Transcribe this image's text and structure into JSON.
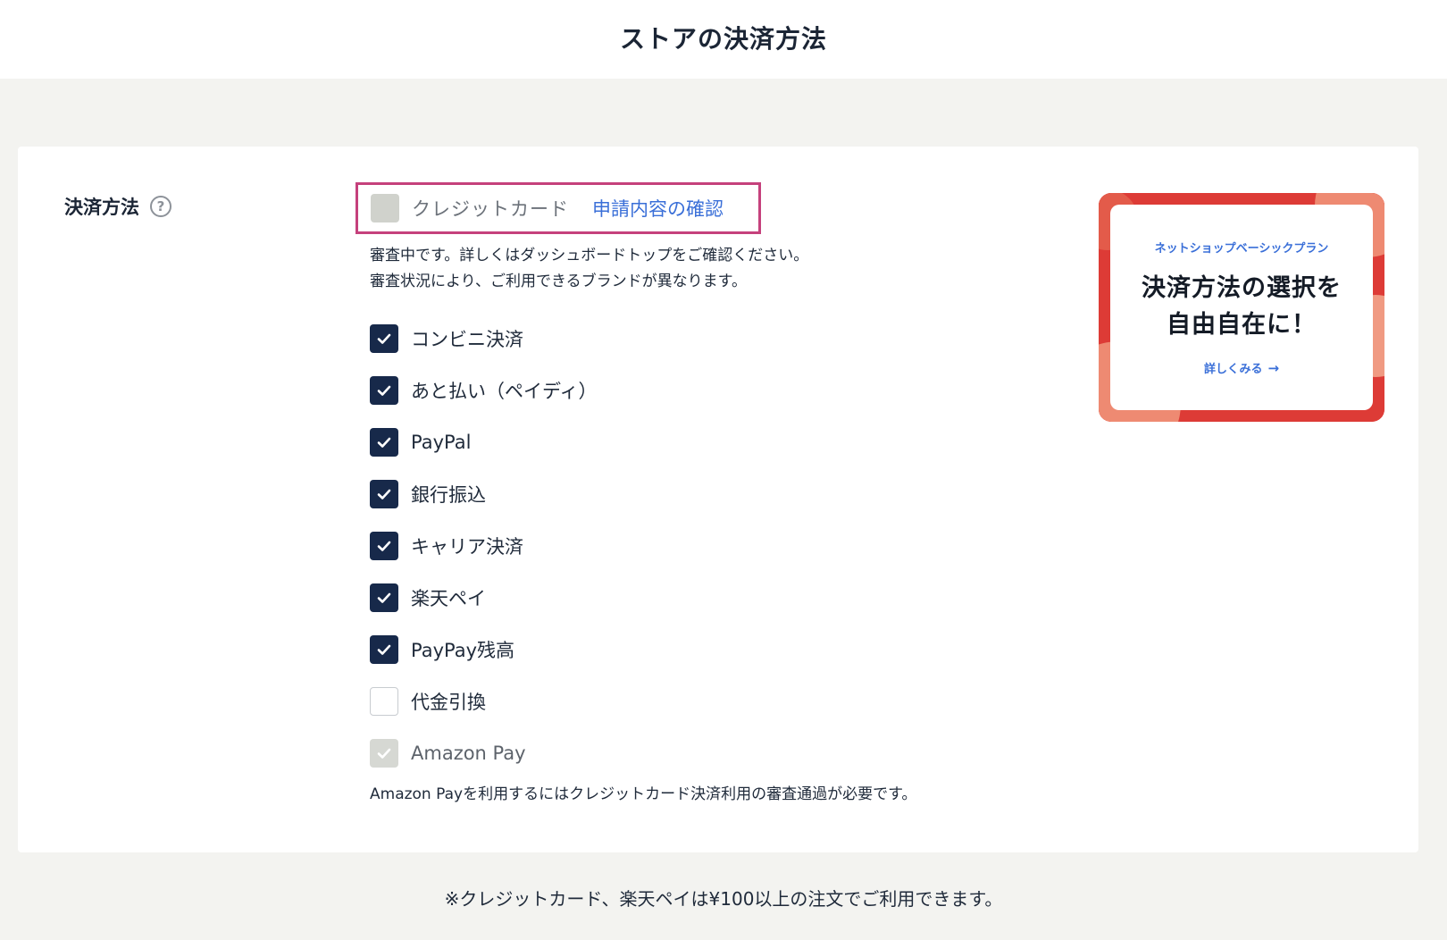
{
  "header": {
    "title": "ストアの決済方法"
  },
  "section": {
    "label": "決済方法",
    "help_icon": "question-circle-icon"
  },
  "credit_card": {
    "label": "クレジットカード",
    "link": "申請内容の確認",
    "state": "disabled-unchecked",
    "highlight_color": "#c5417c"
  },
  "notes": {
    "line1": "審査中です。詳しくはダッシュボードトップをご確認ください。",
    "line2": "審査状況により、ご利用できるブランドが異なります。"
  },
  "methods": [
    {
      "label": "コンビニ決済",
      "state": "checked"
    },
    {
      "label": "あと払い（ペイディ）",
      "state": "checked"
    },
    {
      "label": "PayPal",
      "state": "checked"
    },
    {
      "label": "銀行振込",
      "state": "checked"
    },
    {
      "label": "キャリア決済",
      "state": "checked"
    },
    {
      "label": "楽天ペイ",
      "state": "checked"
    },
    {
      "label": "PayPay残高",
      "state": "checked"
    },
    {
      "label": "代金引換",
      "state": "unchecked"
    },
    {
      "label": "Amazon Pay",
      "state": "disabled-checked"
    }
  ],
  "amazon_note": "Amazon Payを利用するにはクレジットカード決済利用の審査通過が必要です。",
  "promo": {
    "plan": "ネットショップベーシックプラン",
    "headline_line1": "決済方法の選択を",
    "headline_line2": "自由自在に！",
    "cta": "詳しくみる",
    "cta_icon": "arrow-right-icon",
    "accent_color": "#e0403a"
  },
  "footnote": "※クレジットカード、楽天ペイは¥100以上の注文でご利用できます。",
  "colors": {
    "checked": "#17294a",
    "link": "#3a6fd8",
    "page_background": "#f3f3f0"
  }
}
